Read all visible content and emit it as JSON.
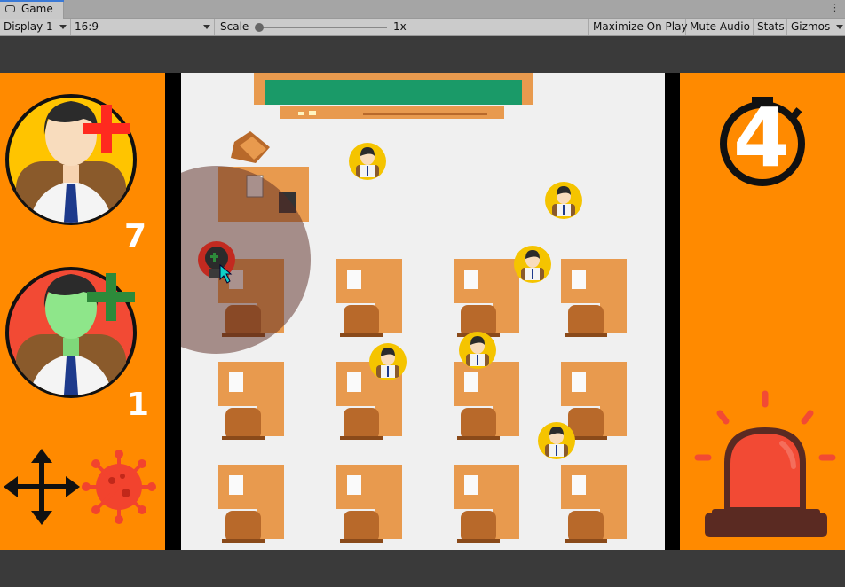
{
  "window": {
    "tab_title": "Game",
    "more_menu": "⋮"
  },
  "toolbar": {
    "display": "Display 1",
    "aspect": "16:9",
    "scale_label": "Scale",
    "scale_value": "1x",
    "maximize": "Maximize On Play",
    "mute": "Mute Audio",
    "stats": "Stats",
    "gizmos": "Gizmos"
  },
  "hud": {
    "uninfected_count": "7",
    "infected_count": "1",
    "timer_value": "4",
    "icons": [
      "healthy-student-plus-icon",
      "infected-student-plus-icon",
      "move-arrows-icon",
      "virus-icon",
      "stopwatch-icon",
      "alarm-siren-icon"
    ]
  },
  "colors": {
    "panel_orange": "#ff8a00",
    "room_floor": "#f0f0f0",
    "desk": "#e89a4e",
    "chair": "#b8692a",
    "chalkboard": "#1a9a68",
    "student_badge": "#f5c400",
    "infected_face": "#8ee68a",
    "plus_red": "#ff2a1f",
    "plus_green": "#2d8a3a",
    "siren_red": "#f24a34"
  }
}
